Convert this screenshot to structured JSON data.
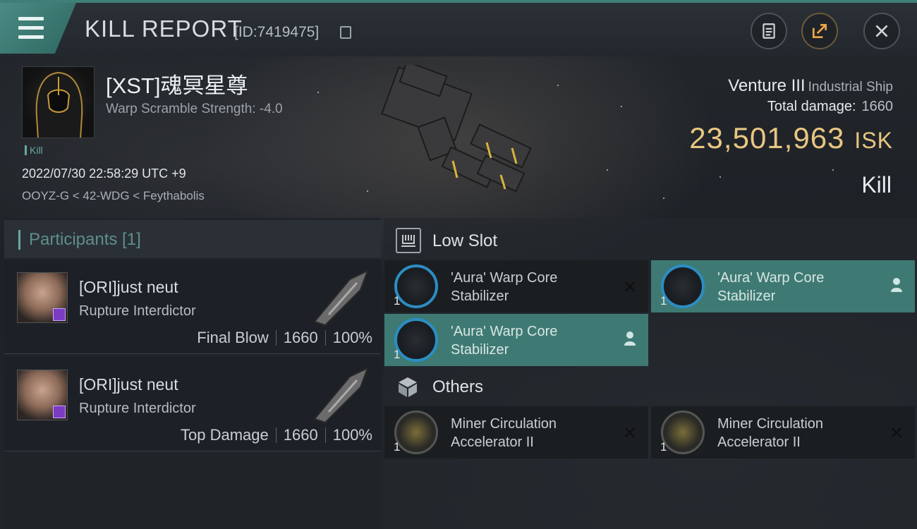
{
  "header": {
    "title": "KILL REPORT",
    "report_id": "[ID:7419475]",
    "buttons": [
      "clipboard-icon",
      "share-icon",
      "close-icon"
    ]
  },
  "victim": {
    "name": "[XST]魂冥星尊",
    "warp_scramble": "Warp Scramble Strength: -4.0",
    "tag": "Kill",
    "datetime": "2022/07/30 22:58:29 UTC +9",
    "location": "OOYZ-G < 42-WDG < Feythabolis"
  },
  "ship": {
    "name": "Venture III",
    "class": "Industrial Ship",
    "total_damage_label": "Total damage:",
    "total_damage": "1660",
    "isk_value": "23,501,963",
    "isk_unit": "ISK",
    "result": "Kill"
  },
  "participants": {
    "header": "Participants [1]",
    "items": [
      {
        "name": "[ORI]just neut",
        "ship": "Rupture Interdictor",
        "role": "Final Blow",
        "damage": "1660",
        "percent": "100%"
      },
      {
        "name": "[ORI]just neut",
        "ship": "Rupture Interdictor",
        "role": "Top Damage",
        "damage": "1660",
        "percent": "100%"
      }
    ]
  },
  "fitting": {
    "low_slot_title": "Low Slot",
    "others_title": "Others",
    "low_slot": [
      {
        "qty": "1",
        "name": "'Aura' Warp Core Stabilizer",
        "status": "destroyed"
      },
      {
        "qty": "1",
        "name": "'Aura' Warp Core Stabilizer",
        "status": "dropped"
      },
      {
        "qty": "1",
        "name": "'Aura' Warp Core Stabilizer",
        "status": "dropped"
      }
    ],
    "others": [
      {
        "qty": "1",
        "name": "Miner Circulation Accelerator II",
        "status": "destroyed"
      },
      {
        "qty": "1",
        "name": "Miner Circulation Accelerator II",
        "status": "destroyed"
      }
    ]
  },
  "colors": {
    "accent": "#3e7a73",
    "isk": "#e9c681"
  }
}
